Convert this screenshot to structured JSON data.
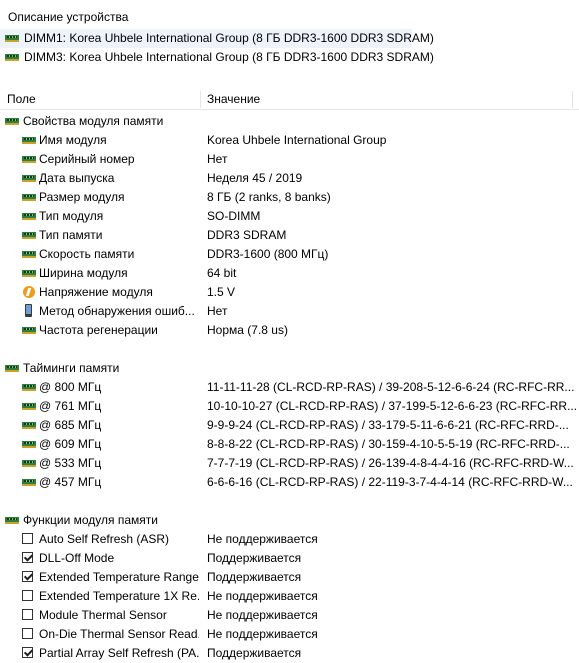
{
  "device_description": {
    "title": "Описание устройства",
    "devices": [
      {
        "label": "DIMM1: Korea Uhbele International Group (8 ГБ DDR3-1600 DDR3 SDRAM)",
        "icon": "ram-module-icon",
        "selected": true
      },
      {
        "label": "DIMM3: Korea Uhbele International Group (8 ГБ DDR3-1600 DDR3 SDRAM)",
        "icon": "ram-module-icon",
        "selected": false
      }
    ]
  },
  "table": {
    "headers": {
      "field": "Поле",
      "value": "Значение"
    },
    "sections": [
      {
        "title": "Свойства модуля памяти",
        "icon": "ram-module-icon",
        "rows": [
          {
            "field": "Имя модуля",
            "value": "Korea Uhbele International Group",
            "icon": "ram-module-icon"
          },
          {
            "field": "Серийный номер",
            "value": "Нет",
            "icon": "ram-module-icon"
          },
          {
            "field": "Дата выпуска",
            "value": "Неделя 45 / 2019",
            "icon": "ram-module-icon"
          },
          {
            "field": "Размер модуля",
            "value": "8 ГБ (2 ranks, 8 banks)",
            "icon": "ram-module-icon"
          },
          {
            "field": "Тип модуля",
            "value": "SO-DIMM",
            "icon": "ram-module-icon"
          },
          {
            "field": "Тип памяти",
            "value": "DDR3 SDRAM",
            "icon": "ram-module-icon"
          },
          {
            "field": "Скорость памяти",
            "value": "DDR3-1600 (800 МГц)",
            "icon": "ram-module-icon"
          },
          {
            "field": "Ширина модуля",
            "value": "64 bit",
            "icon": "ram-module-icon"
          },
          {
            "field": "Напряжение модуля",
            "value": "1.5 V",
            "icon": "voltage-icon"
          },
          {
            "field": "Метод обнаружения ошиб...",
            "value": "Нет",
            "icon": "device-icon"
          },
          {
            "field": "Частота регенерации",
            "value": "Норма (7.8 us)",
            "icon": "ram-module-icon"
          }
        ]
      },
      {
        "title": "Тайминги памяти",
        "icon": "ram-module-icon",
        "rows": [
          {
            "field": "@ 800 МГц",
            "value": "11-11-11-28  (CL-RCD-RP-RAS) / 39-208-5-12-6-6-24  (RC-RFC-RR...",
            "icon": "ram-module-icon"
          },
          {
            "field": "@ 761 МГц",
            "value": "10-10-10-27  (CL-RCD-RP-RAS) / 37-199-5-12-6-6-23  (RC-RFC-RR...",
            "icon": "ram-module-icon"
          },
          {
            "field": "@ 685 МГц",
            "value": "9-9-9-24  (CL-RCD-RP-RAS) / 33-179-5-11-6-6-21  (RC-RFC-RRD-...",
            "icon": "ram-module-icon"
          },
          {
            "field": "@ 609 МГц",
            "value": "8-8-8-22  (CL-RCD-RP-RAS) / 30-159-4-10-5-5-19  (RC-RFC-RRD-...",
            "icon": "ram-module-icon"
          },
          {
            "field": "@ 533 МГц",
            "value": "7-7-7-19  (CL-RCD-RP-RAS) / 26-139-4-8-4-4-16  (RC-RFC-RRD-W...",
            "icon": "ram-module-icon"
          },
          {
            "field": "@ 457 МГц",
            "value": "6-6-6-16  (CL-RCD-RP-RAS) / 22-119-3-7-4-4-14  (RC-RFC-RRD-W...",
            "icon": "ram-module-icon"
          }
        ]
      },
      {
        "title": "Функции модуля памяти",
        "icon": "ram-module-icon",
        "rows": [
          {
            "field": "Auto Self Refresh (ASR)",
            "value": "Не поддерживается",
            "checked": false
          },
          {
            "field": "DLL-Off Mode",
            "value": "Поддерживается",
            "checked": true
          },
          {
            "field": "Extended Temperature Range",
            "value": "Поддерживается",
            "checked": true
          },
          {
            "field": "Extended Temperature 1X Re...",
            "value": "Не поддерживается",
            "checked": false
          },
          {
            "field": "Module Thermal Sensor",
            "value": "Не поддерживается",
            "checked": false
          },
          {
            "field": "On-Die Thermal Sensor Read...",
            "value": "Не поддерживается",
            "checked": false
          },
          {
            "field": "Partial Array Self Refresh (PA...",
            "value": "Поддерживается",
            "checked": true
          }
        ]
      }
    ]
  }
}
